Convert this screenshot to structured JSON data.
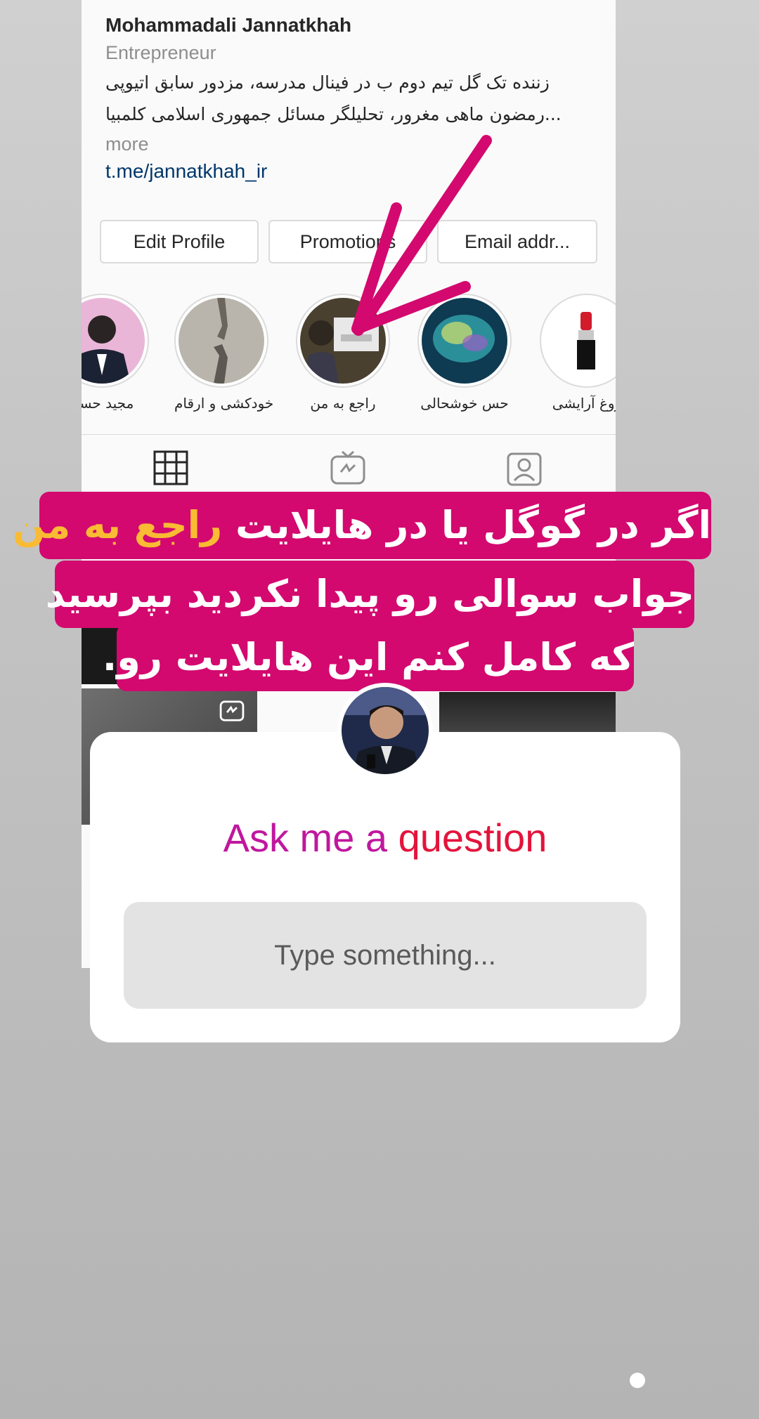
{
  "profile": {
    "name": "Mohammadali Jannatkhah",
    "category": "Entrepreneur",
    "bio_line1": "زننده تک گل تیم دوم ب در فینال مدرسه، مزدور سابق اتیوپی",
    "bio_line2": "رمضون ماهی مغرور، تحلیلگر مسائل جمهوری اسلامی کلمبیا...",
    "more": "more",
    "link": "t.me/jannatkhah_ir"
  },
  "buttons": {
    "edit_profile": "Edit Profile",
    "promotions": "Promotions",
    "email": "Email addr..."
  },
  "highlights": [
    {
      "label": "!مجید حسـ"
    },
    {
      "label": "خودکشی و ارقام"
    },
    {
      "label": "راجع به من"
    },
    {
      "label": "حس خوشحالی"
    },
    {
      "label": "روغ آرایشی"
    }
  ],
  "tabs": [
    "grid-icon",
    "igtv-icon",
    "tagged-icon"
  ],
  "banner": {
    "line1_part1": "اگر در گوگل یا در هایلایت ",
    "line1_highlight": "راجع به من",
    "line2": "جواب سوالی رو پیدا نکردید بپرسید",
    "line3": "که کامل کنم این هایلایت رو."
  },
  "sticker": {
    "title_part1": "Ask me a ",
    "title_part2": "question",
    "placeholder": "Type something..."
  },
  "colors": {
    "banner_bg": "#d3096f",
    "banner_highlight": "#f9bb33",
    "arrow": "#d3096f",
    "title_magenta": "#c0179d",
    "title_red": "#e3143b"
  }
}
